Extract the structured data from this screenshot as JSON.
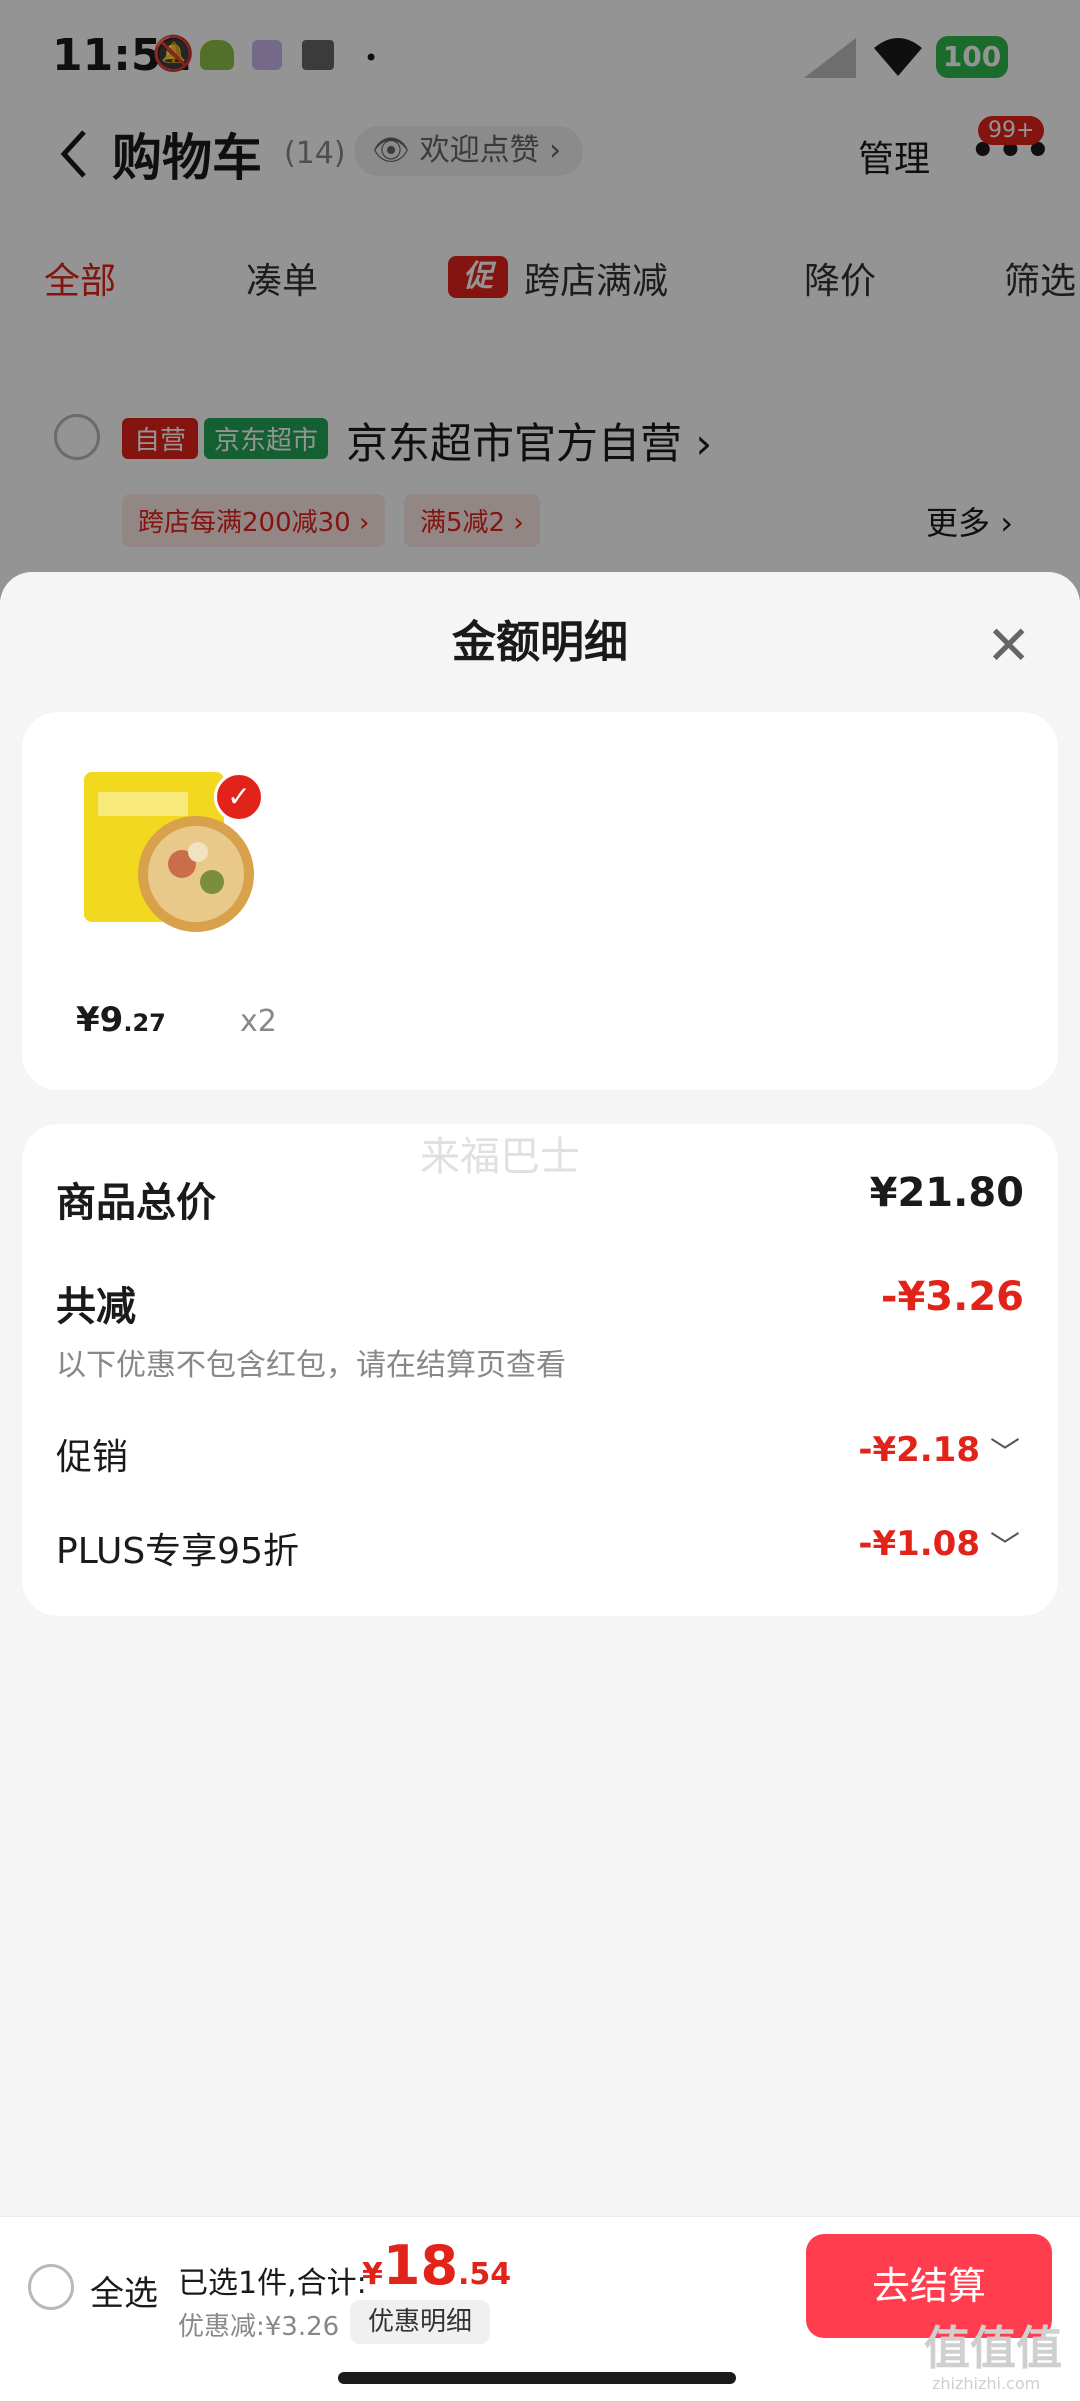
{
  "status_bar": {
    "time": "11:52",
    "battery": "100"
  },
  "header": {
    "title": "购物车",
    "count": "(14)",
    "welcome": "欢迎点赞",
    "manage": "管理",
    "badge": "99+"
  },
  "tabs": [
    {
      "label": "全部",
      "active": true
    },
    {
      "label": "凑单"
    },
    {
      "label": "跨店满减",
      "tag": "促"
    },
    {
      "label": "降价"
    },
    {
      "label": "筛选"
    }
  ],
  "store": {
    "tag_self": "自营",
    "tag_market": "京东超市",
    "name": "京东超市官方自营",
    "coupons": [
      "跨店每满200减30",
      "满5减2"
    ],
    "more": "更多"
  },
  "sheet": {
    "title": "金额明细",
    "product": {
      "price_currency": "¥",
      "price_int": "9",
      "price_dec": ".27",
      "qty": "x2"
    },
    "watermark": "来福巴士",
    "total_label": "商品总价",
    "total_value": "¥21.80",
    "discount_label": "共减",
    "discount_value": "-¥3.26",
    "note": "以下优惠不包含红包，请在结算页查看",
    "items": [
      {
        "label": "促销",
        "value": "-¥2.18"
      },
      {
        "label": "PLUS专享95折",
        "value": "-¥1.08"
      }
    ]
  },
  "bottom": {
    "select_all": "全选",
    "summary_label": "已选1件,合计:",
    "currency": "¥",
    "amount_int": "18",
    "amount_dec": ".54",
    "saved": "优惠减:¥3.26",
    "detail_button": "优惠明细",
    "checkout": "去结算"
  },
  "watermark_corner": {
    "logo": "值值值",
    "site": "zhizhizhi.com"
  },
  "colors": {
    "accent": "#e2231a",
    "checkout": "#ff3d4f",
    "green_tag": "#24a658"
  }
}
